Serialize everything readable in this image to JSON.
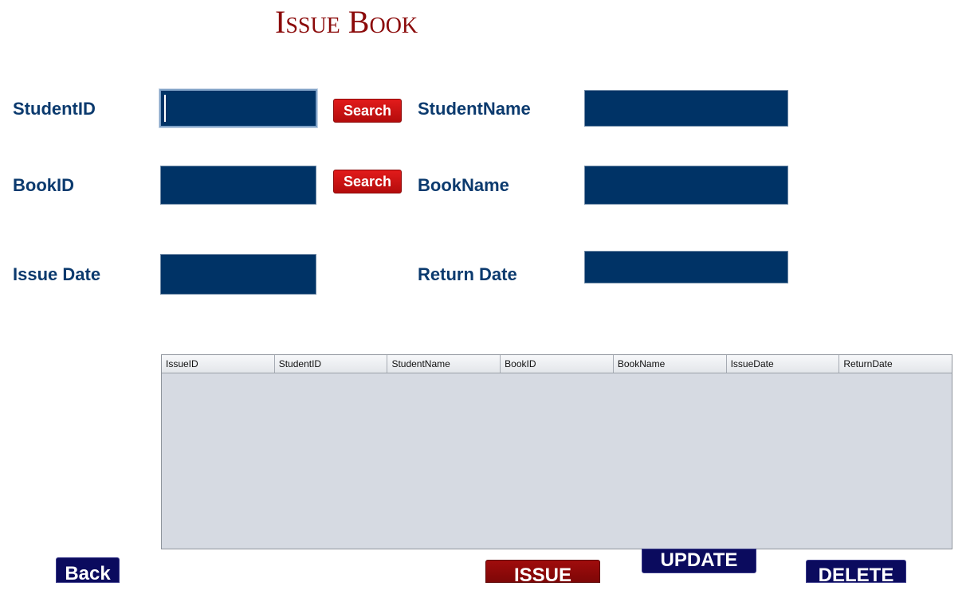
{
  "page": {
    "title": "Issue Book"
  },
  "form": {
    "student_id": {
      "label": "StudentID",
      "value": ""
    },
    "student_name": {
      "label": "StudentName",
      "value": ""
    },
    "book_id": {
      "label": "BookID",
      "value": ""
    },
    "book_name": {
      "label": "BookName",
      "value": ""
    },
    "issue_date": {
      "label": "Issue Date",
      "value": ""
    },
    "return_date": {
      "label": "Return Date",
      "value": ""
    },
    "search_student_label": "Search",
    "search_book_label": "Search"
  },
  "table": {
    "columns": [
      "IssueID",
      "StudentID",
      "StudentName",
      "BookID",
      "BookName",
      "IssueDate",
      "ReturnDate"
    ],
    "rows": []
  },
  "actions": {
    "back_label": "Back",
    "issue_label": "ISSUE",
    "update_label": "UPDATE",
    "delete_label": "DELETE"
  },
  "colors": {
    "title": "#8b0a0a",
    "label": "#0b3a6e",
    "field_bg": "#003366",
    "search_button": "#d11414",
    "navy_button": "#0b0b5e",
    "red_button": "#8e0a0a",
    "table_bg": "#d6dae2"
  }
}
